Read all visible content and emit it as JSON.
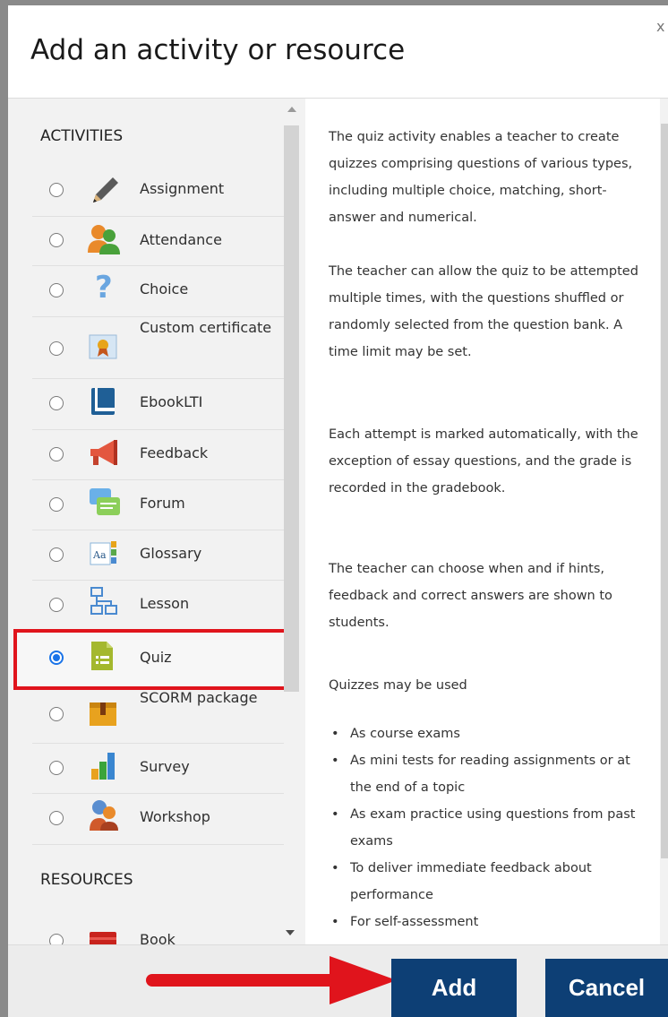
{
  "dialog": {
    "title": "Add an activity or resource",
    "close_glyph": "x"
  },
  "list": {
    "activities_heading": "ACTIVITIES",
    "resources_heading": "RESOURCES",
    "items": [
      {
        "label": "Assignment",
        "icon": "pencil-icon",
        "checked": false
      },
      {
        "label": "Attendance",
        "icon": "people-icon",
        "checked": false
      },
      {
        "label": "Choice",
        "icon": "question-mark-icon",
        "checked": false
      },
      {
        "label": "Custom certificate",
        "icon": "certificate-icon",
        "checked": false
      },
      {
        "label": "EbookLTI",
        "icon": "book-icon",
        "checked": false
      },
      {
        "label": "Feedback",
        "icon": "megaphone-icon",
        "checked": false
      },
      {
        "label": "Forum",
        "icon": "chat-bubbles-icon",
        "checked": false
      },
      {
        "label": "Glossary",
        "icon": "glossary-icon",
        "checked": false
      },
      {
        "label": "Lesson",
        "icon": "flowchart-icon",
        "checked": false
      },
      {
        "label": "Quiz",
        "icon": "quiz-icon",
        "checked": true
      },
      {
        "label": "SCORM package",
        "icon": "package-icon",
        "checked": false
      },
      {
        "label": "Survey",
        "icon": "bar-chart-icon",
        "checked": false
      },
      {
        "label": "Workshop",
        "icon": "workshop-icon",
        "checked": false
      }
    ],
    "resources": [
      {
        "label": "Book",
        "icon": "folder-book-icon",
        "checked": false
      }
    ]
  },
  "description": {
    "p1": "The quiz activity enables a teacher to create quizzes comprising questions of various types, including multiple choice, matching, short-answer and numerical.",
    "p2": "The teacher can allow the quiz to be attempted multiple times, with the questions shuffled or randomly selected from the question bank. A time limit may be set.",
    "p3": "Each attempt is marked automatically, with the exception of essay questions, and the grade is recorded in the gradebook.",
    "p4": "The teacher can choose when and if hints, feedback and correct answers are shown to students.",
    "p5": "Quizzes may be used",
    "bullets": [
      "As course exams",
      "As mini tests for reading assignments or at the end of a topic",
      "As exam practice using questions from past exams",
      "To deliver immediate feedback about performance",
      "For self-assessment"
    ]
  },
  "footer": {
    "add_label": "Add",
    "cancel_label": "Cancel"
  },
  "colors": {
    "button": "#0d3f75",
    "highlight": "#e0141c",
    "radio": "#1a73e8"
  }
}
